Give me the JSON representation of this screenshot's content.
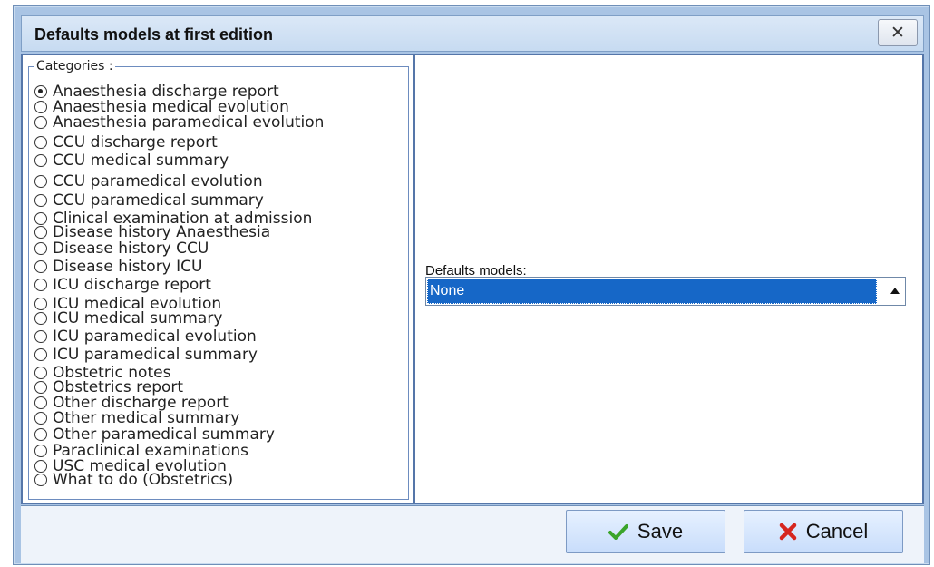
{
  "window": {
    "title": "Defaults models at first edition",
    "close_icon": "close-icon"
  },
  "categories": {
    "label": "Categories :",
    "selected_index": 0,
    "items": [
      "Anaesthesia discharge report",
      "Anaesthesia medical evolution",
      "Anaesthesia paramedical evolution",
      "CCU discharge report",
      "CCU medical summary",
      "CCU paramedical evolution",
      "CCU paramedical summary",
      "Clinical examination at admission",
      "Disease history Anaesthesia",
      "Disease history CCU",
      "Disease history ICU",
      "ICU discharge report",
      "ICU medical evolution",
      "ICU medical summary",
      "ICU paramedical evolution",
      "ICU paramedical summary",
      "Obstetric notes",
      "Obstetrics report",
      "Other discharge report",
      "Other medical summary",
      "Other paramedical summary",
      "Paraclinical examinations",
      "USC medical evolution",
      "What to do (Obstetrics)"
    ]
  },
  "defaults_models": {
    "label": "Defaults models:",
    "selected": "None",
    "arrow_icon": "triangle-up-icon"
  },
  "actions": {
    "save_label": "Save",
    "cancel_label": "Cancel",
    "save_icon": "checkmark-icon",
    "cancel_icon": "x-icon",
    "save_color": "#3aa42a",
    "cancel_color": "#d6261f"
  }
}
